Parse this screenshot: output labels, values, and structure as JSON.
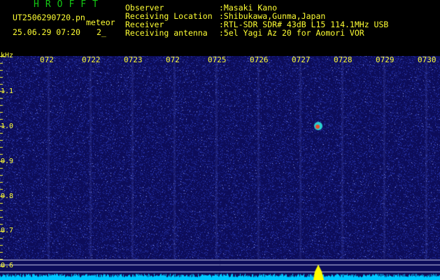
{
  "header": {
    "title": "HROFFT",
    "filename": "UT2506290720.pn",
    "meteor_label": "meteor",
    "timestamp": "25.06.29 07:20",
    "count": "2_",
    "observer_label": "Observer",
    "observer_value": ":Masaki Kano",
    "location_label": "Receiving Location",
    "location_value": ":Shibukawa,Gunma,Japan",
    "receiver_label": "Receiver",
    "receiver_value": ":RTL-SDR SDR# 43dB L15 114.1MHz USB",
    "antenna_label": "Receiving antenna",
    "antenna_value": ":5el Yagi Az 20 for Aomori VOR"
  },
  "time_ticks": [
    "072",
    "0722",
    "0723",
    "072",
    "0725",
    "0726",
    "0727",
    "0728",
    "0729",
    "0730"
  ],
  "freq_axis": {
    "unit": "kHz",
    "ticks": [
      "1.1",
      "1.0",
      "0.9",
      "0.8",
      "0.7",
      "0.6"
    ]
  },
  "colors": {
    "background": "#0d0d5a",
    "noise": "#3b4bd0",
    "meteor_echo": "#e84a2a",
    "carrier": "#00c8ff",
    "text": "#ffff33",
    "title": "#14c814"
  }
}
